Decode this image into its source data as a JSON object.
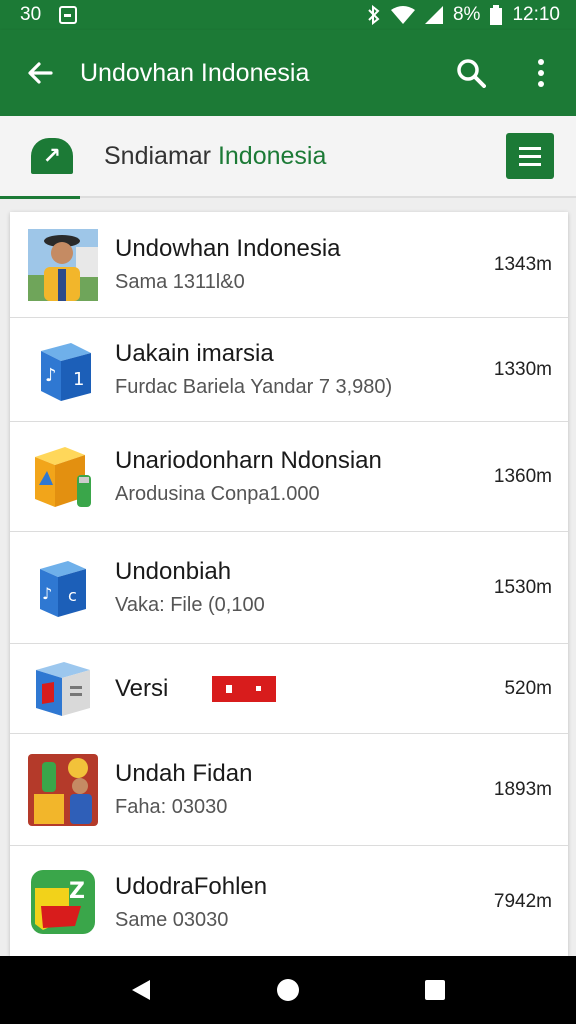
{
  "status": {
    "time_left": "30",
    "battery": "8%",
    "clock": "12:10"
  },
  "appbar": {
    "title": "Undovhan Indonesia"
  },
  "subbar": {
    "title_prefix": "Sndiamar ",
    "title_highlight": "Indonesia"
  },
  "items": [
    {
      "name": "Undowhan Indonesia",
      "sub": "Sama 1311l&0",
      "size": "1343m",
      "icon": "person-photo-icon"
    },
    {
      "name": "Uakain imarsia",
      "sub": "Furdac Bariela Yandar 7 3,980)",
      "size": "1330m",
      "icon": "blue-cube-icon"
    },
    {
      "name": "Unariodonharn Ndonsian",
      "sub": "Arodusina Conpa1.000",
      "size": "1360m",
      "icon": "yellow-box-icon"
    },
    {
      "name": "Undonbiah",
      "sub": "Vaka: File  (0,100",
      "size": "1530m",
      "icon": "blue-box-icon"
    },
    {
      "name": "Versi",
      "sub": "",
      "size": "520m",
      "icon": "blue-red-cube-icon"
    },
    {
      "name": "Undah Fidan",
      "sub": "Faha: 03030",
      "size": "1893m",
      "icon": "illustration-icon"
    },
    {
      "name": "UdodraFohlen",
      "sub": "Same 03030",
      "size": "7942m",
      "icon": "green-red-app-icon"
    }
  ]
}
